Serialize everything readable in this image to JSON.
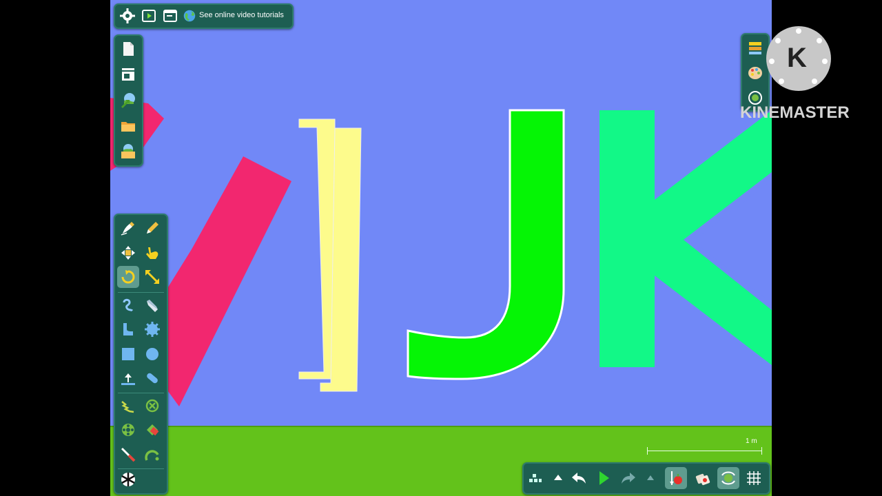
{
  "topbar": {
    "tutorials_link": "See online video tutorials",
    "icons": [
      "gear-icon",
      "play-preview-icon",
      "window-icon",
      "globe-icon"
    ]
  },
  "file_panel": {
    "icons": [
      "new-document-icon",
      "layout-icon",
      "landscape-export-icon",
      "open-folder-icon",
      "landscape-folder-icon"
    ]
  },
  "tool_panel": {
    "active_tool": "rotate-icon",
    "icons": [
      "draw-pencil-icon",
      "erase-pencil-icon",
      "move-icon",
      "drag-hand-icon",
      "rotate-icon",
      "scale-icon",
      "rope-icon",
      "knife-icon",
      "bend-shape-icon",
      "gear-shape-icon",
      "square-icon",
      "circle-icon",
      "fixpoint-icon",
      "capsule-icon",
      "spring-icon",
      "no-collide-icon",
      "wheel-icon",
      "thruster-icon",
      "laser-icon",
      "hinge-icon",
      "spiral-icon"
    ]
  },
  "right_panel": {
    "icons": [
      "layers-icon",
      "palette-icon",
      "settings-green-icon"
    ]
  },
  "bottom_bar": {
    "icons": [
      "grid-menu-icon",
      "up-arrow-icon",
      "undo-icon",
      "play-icon",
      "redo-icon",
      "up-arrow-icon-2",
      "gravity-apple-icon",
      "clone-icon",
      "cycle-icon",
      "grid-icon"
    ]
  },
  "scale": {
    "label": "1 m"
  },
  "watermark": {
    "text": "KINEMASTER",
    "letter": "K"
  },
  "colors": {
    "sky": "#7188f7",
    "ground": "#63c21b",
    "letter_i": "#f2276f",
    "letter_bracket": "#fdfb8c",
    "letter_j": "#05f505",
    "letter_k": "#12f887",
    "panel": "#1d5e52"
  }
}
